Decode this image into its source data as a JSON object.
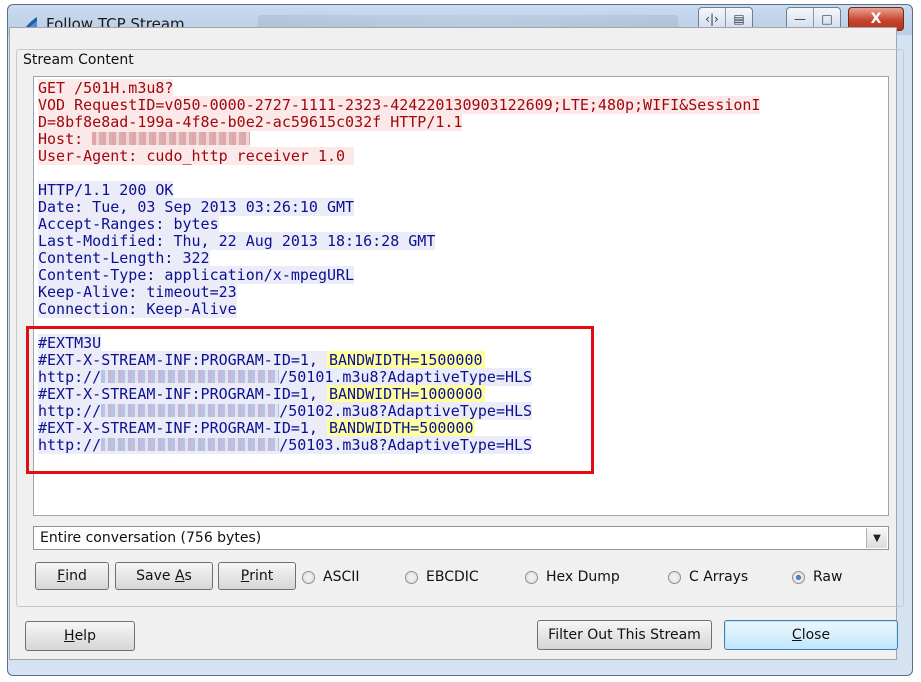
{
  "window": {
    "title": "Follow TCP Stream",
    "controls": {
      "restore_icon": "restore-icon",
      "minimize": "minimize-icon",
      "maximize": "maximize-icon",
      "close": "X"
    }
  },
  "stream_group_label": "Stream Content",
  "request_lines": [
    {
      "pre": "GET /501H.m3u8?",
      "masked": 0,
      "post": ""
    },
    {
      "pre": "VOD_RequestID=v050-0000-2727-1111-2323-424220130903122609;LTE;480p;WIFI&SessionI",
      "masked": 0,
      "post": ""
    },
    {
      "pre": "D=8bf8e8ad-199a-4f8e-b0e2-ac59615c032f HTTP/1.1",
      "masked": 0,
      "post": ""
    },
    {
      "pre": "Host: ",
      "masked": 1,
      "post": ""
    },
    {
      "pre": "User-Agent: cudo_http receiver 1.0 ",
      "masked": 0,
      "post": ""
    }
  ],
  "response_headers": [
    "HTTP/1.1 200 OK",
    "Date: Tue, 03 Sep 2013 03:26:10 GMT",
    "Accept-Ranges: bytes",
    "Last-Modified: Thu, 22 Aug 2013 18:16:28 GMT",
    "Content-Length: 322",
    "Content-Type: application/x-mpegURL",
    "Keep-Alive: timeout=23",
    "Connection: Keep-Alive"
  ],
  "playlist": {
    "header": "#EXTM3U",
    "streams": [
      {
        "inf": "#EXT-X-STREAM-INF:PROGRAM-ID=1, ",
        "bandwidth": "BANDWIDTH=1500000",
        "url_prefix": "http://",
        "url_suffix": "/50101.m3u8?AdaptiveType=HLS"
      },
      {
        "inf": "#EXT-X-STREAM-INF:PROGRAM-ID=1, ",
        "bandwidth": "BANDWIDTH=1000000",
        "url_prefix": "http://",
        "url_suffix": "/50102.m3u8?AdaptiveType=HLS"
      },
      {
        "inf": "#EXT-X-STREAM-INF:PROGRAM-ID=1, ",
        "bandwidth": "BANDWIDTH=500000",
        "url_prefix": "http://",
        "url_suffix": "/50103.m3u8?AdaptiveType=HLS"
      }
    ]
  },
  "conversation_select": {
    "selected": "Entire conversation (756 bytes)"
  },
  "buttons": {
    "find": {
      "mnemonic": "F",
      "rest": "ind"
    },
    "save_as": {
      "pre": "Save ",
      "mnemonic": "A",
      "rest": "s"
    },
    "print": {
      "mnemonic": "P",
      "rest": "rint"
    },
    "help": {
      "mnemonic": "H",
      "rest": "elp"
    },
    "filter_out": "Filter Out This Stream",
    "close": {
      "mnemonic": "C",
      "rest": "lose"
    }
  },
  "formats": [
    {
      "label": "ASCII",
      "selected": false
    },
    {
      "label": "EBCDIC",
      "selected": false
    },
    {
      "label": "Hex Dump",
      "selected": false
    },
    {
      "label": "C Arrays",
      "selected": false
    },
    {
      "label": "Raw",
      "selected": true
    }
  ],
  "colors": {
    "request_text": "#a0080e",
    "request_bg": "#fbe9e9",
    "response_text": "#0a1192",
    "response_bg": "#ececf8",
    "bandwidth_highlight": "#ffff9e",
    "annotation_box": "#e00e13"
  }
}
